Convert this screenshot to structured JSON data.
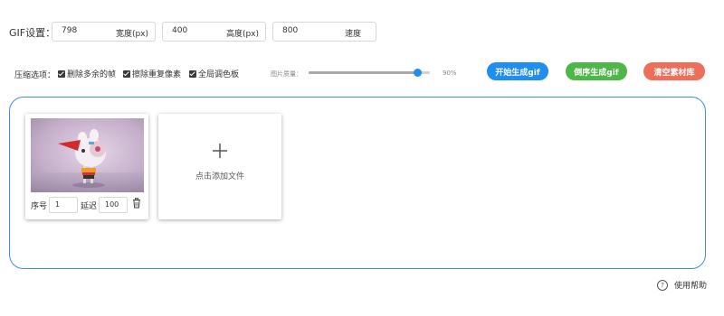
{
  "gif_settings": {
    "label": "GIF设置：",
    "width": {
      "value": "798",
      "unit": "宽度(px)"
    },
    "height": {
      "value": "400",
      "unit": "高度(px)"
    },
    "speed": {
      "value": "800",
      "unit": "速度"
    }
  },
  "compression": {
    "label": "压缩选项：",
    "options": [
      {
        "label": "删除多余的帧",
        "checked": true
      },
      {
        "label": "擦除重复像素",
        "checked": true
      },
      {
        "label": "全局调色板",
        "checked": true
      }
    ],
    "quality_label": "图片质量：",
    "quality_value": "90%",
    "quality_level": 0.9
  },
  "buttons": {
    "start": {
      "label": "开始生成gif",
      "color": "#1f8ef1"
    },
    "reverse": {
      "label": "倒序生成gif",
      "color": "#4db748"
    },
    "clear": {
      "label": "清空素材库",
      "color": "#ef6e5a"
    }
  },
  "frames": [
    {
      "seq_label": "序号",
      "seq_value": "1",
      "delay_label": "延迟",
      "delay_value": "100"
    }
  ],
  "add_card": {
    "label": "点击添加文件"
  },
  "help": {
    "label": "使用帮助"
  },
  "colors": {
    "accent": "#3b8fe8"
  }
}
